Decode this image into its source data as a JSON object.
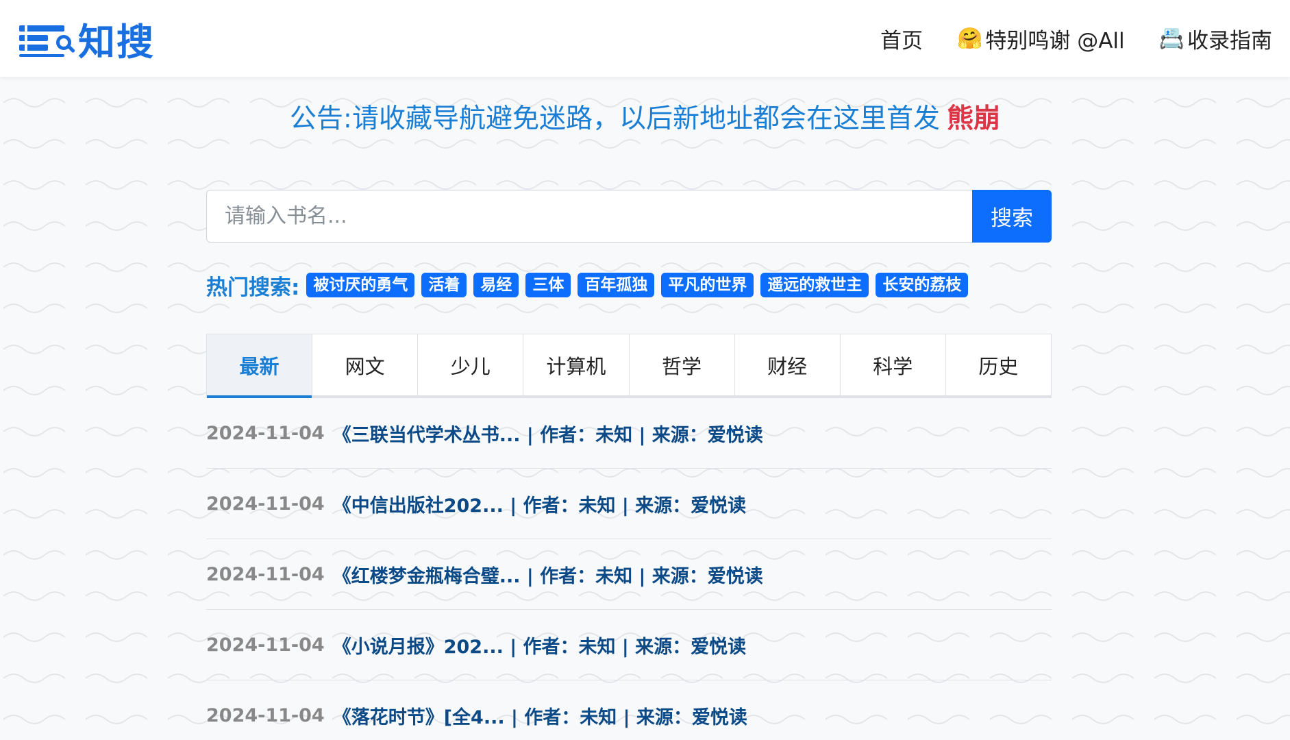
{
  "brand": {
    "name": "知搜",
    "logo_icon": "database-search-icon",
    "accent": "#1a6fe0"
  },
  "nav": {
    "items": [
      {
        "label": "首页",
        "emoji": ""
      },
      {
        "label": "特别鸣谢 @All",
        "emoji": "🤗"
      },
      {
        "label": "收录指南",
        "emoji": "📇"
      }
    ]
  },
  "notice": {
    "text": "公告:请收藏导航避免迷路，以后新地址都会在这里首发",
    "highlight": "熊崩"
  },
  "search": {
    "placeholder": "请输入书名...",
    "value": "",
    "button": "搜索"
  },
  "hot": {
    "label": "热门搜索:",
    "tags": [
      "被讨厌的勇气",
      "活着",
      "易经",
      "三体",
      "百年孤独",
      "平凡的世界",
      "遥远的救世主",
      "长安的荔枝"
    ]
  },
  "tabs": {
    "active_index": 0,
    "items": [
      "最新",
      "网文",
      "少儿",
      "计算机",
      "哲学",
      "财经",
      "科学",
      "历史"
    ]
  },
  "list": {
    "items": [
      {
        "date": "2024-11-04",
        "title": "《三联当代学术丛书... | 作者：未知 | 来源：爱悦读"
      },
      {
        "date": "2024-11-04",
        "title": "《中信出版社202... | 作者：未知 | 来源：爱悦读"
      },
      {
        "date": "2024-11-04",
        "title": "《红楼梦金瓶梅合璧... | 作者：未知 | 来源：爱悦读"
      },
      {
        "date": "2024-11-04",
        "title": "《小说月报》202... | 作者：未知 | 来源：爱悦读"
      },
      {
        "date": "2024-11-04",
        "title": "《落花时节》[全4... | 作者：未知 | 来源：爱悦读"
      }
    ]
  }
}
